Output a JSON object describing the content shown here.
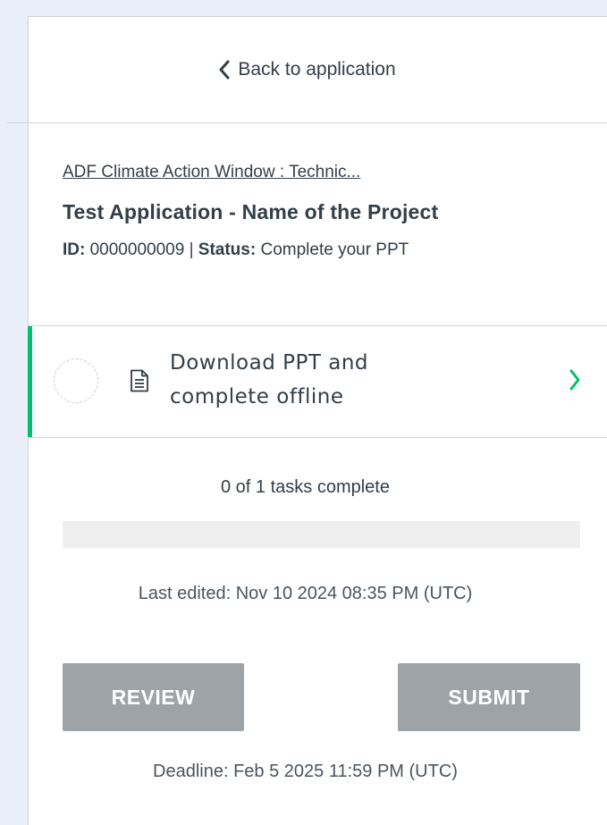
{
  "back": {
    "label": "Back to application",
    "icon": "chevron-left-icon"
  },
  "application": {
    "program_link": "ADF Climate Action Window : Technic...",
    "title": "Test Application - Name of the Project",
    "id_label": "ID:",
    "id_value": "0000000009",
    "separator": "|",
    "status_label": "Status:",
    "status_value": "Complete your PPT"
  },
  "task": {
    "label_line1": "Download PPT and",
    "label_line2": "complete offline",
    "status": "incomplete",
    "icon": "document-icon",
    "accent_color": "#00bf6f"
  },
  "progress": {
    "text": "0 of 1 tasks complete",
    "completed": 0,
    "total": 1,
    "fraction": 0
  },
  "last_edited": "Last edited: Nov 10 2024 08:35 PM (UTC)",
  "actions": {
    "review_label": "REVIEW",
    "submit_label": "SUBMIT",
    "disabled_color": "#9ea3a8"
  },
  "deadline": "Deadline: Feb 5 2025 11:59 PM (UTC)"
}
